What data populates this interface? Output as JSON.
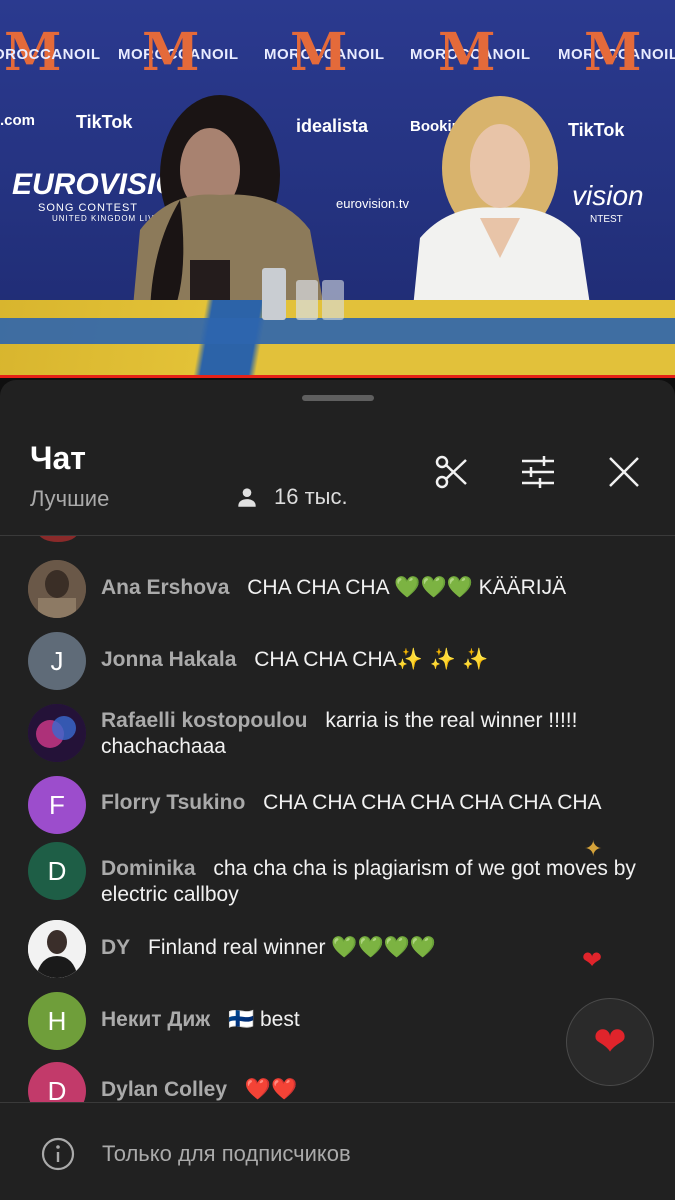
{
  "video": {
    "brand_text": "MOROCCANOIL",
    "sponsors": [
      ".com",
      "TikTok",
      "idealista",
      "Booking.c",
      "TikTok"
    ],
    "event_logo": "EUROVISION",
    "event_sub": "SONG CONTEST",
    "event_sub2": "UNITED KINGDOM LIVERPOOL 2023",
    "event_url": "eurovision.tv",
    "event_logo_right": "vision",
    "event_sub_right": "NTEST",
    "progress_fraction": 1.0
  },
  "chat": {
    "title": "Чат",
    "filter_label": "Лучшие",
    "viewers_count": "16 тыс.",
    "messages": [
      {
        "author": "Ana Ershova",
        "text": "CHA CHA CHA",
        "emoji": "💚💚💚",
        "text2": "KÄÄRIJÄ",
        "avatar_letter": "",
        "avatar_color": "#5a4a3e"
      },
      {
        "author": "Jonna Hakala",
        "text": "CHA CHA CHA",
        "emoji": "✨ ✨ ✨",
        "text2": "",
        "avatar_letter": "J",
        "avatar_color": "#5f6b78"
      },
      {
        "author": "Rafaelli kostopoulou",
        "text": "karria is the real winner !!!!! chachachaaa",
        "emoji": "",
        "text2": "",
        "avatar_letter": "",
        "avatar_color": "#3a1f5c"
      },
      {
        "author": "Florry Tsukino",
        "text": "CHA CHA CHA CHA CHA CHA CHA",
        "emoji": "",
        "text2": "",
        "avatar_letter": "F",
        "avatar_color": "#9c4dcc"
      },
      {
        "author": "Dominika",
        "text": "cha cha cha is plagiarism of we got moves by electric callboy",
        "emoji": "",
        "text2": "",
        "avatar_letter": "D",
        "avatar_color": "#1e5e46"
      },
      {
        "author": "DY",
        "text": "Finland real winner",
        "emoji": "💚💚💚💚",
        "text2": "",
        "avatar_letter": "",
        "avatar_color": "#e8e8e8"
      },
      {
        "author": "Некит Диж",
        "text": "best",
        "emoji": "🇫🇮",
        "text2": "",
        "avatar_letter": "H",
        "avatar_color": "#6f9e3a"
      },
      {
        "author": "Dylan Colley",
        "text": "",
        "emoji": "❤️❤️",
        "text2": "",
        "avatar_letter": "D",
        "avatar_color": "#c23a6a"
      }
    ],
    "footer_text": "Только для подписчиков"
  },
  "icons": {
    "people": "people-icon",
    "scissors": "scissors-icon",
    "filter": "filter-sliders-icon",
    "close": "close-icon",
    "info": "info-icon",
    "heart": "heart-icon"
  },
  "colors": {
    "panel_bg": "#212121",
    "author": "#aaaaaa",
    "progress": "#e62117",
    "heart": "#e0242b"
  }
}
